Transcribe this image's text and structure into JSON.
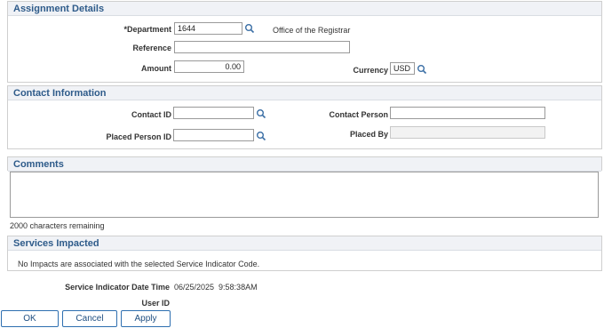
{
  "assignment": {
    "title": "Assignment Details",
    "department_label": "*Department",
    "department_value": "1644",
    "department_desc": "Office of the Registrar",
    "reference_label": "Reference",
    "reference_value": "",
    "amount_label": "Amount",
    "amount_value": "0.00",
    "currency_label": "Currency",
    "currency_value": "USD"
  },
  "contact": {
    "title": "Contact Information",
    "contact_id_label": "Contact ID",
    "contact_id_value": "",
    "contact_person_label": "Contact Person",
    "contact_person_value": "",
    "placed_person_id_label": "Placed Person ID",
    "placed_person_id_value": "",
    "placed_by_label": "Placed By",
    "placed_by_value": ""
  },
  "comments": {
    "title": "Comments",
    "value": "",
    "remaining": "2000 characters remaining"
  },
  "services": {
    "title": "Services Impacted",
    "message": "No Impacts are associated with the selected Service Indicator Code."
  },
  "footer": {
    "datetime_label": "Service Indicator Date Time",
    "datetime_value": "06/25/2025  9:58:38AM",
    "user_id_label": "User ID",
    "user_id_value": ""
  },
  "buttons": {
    "ok": "OK",
    "cancel": "Cancel",
    "apply": "Apply"
  },
  "colors": {
    "section_title": "#2e5b8a",
    "header_bg": "#f0f2f6",
    "button_border": "#2e6fb0"
  }
}
